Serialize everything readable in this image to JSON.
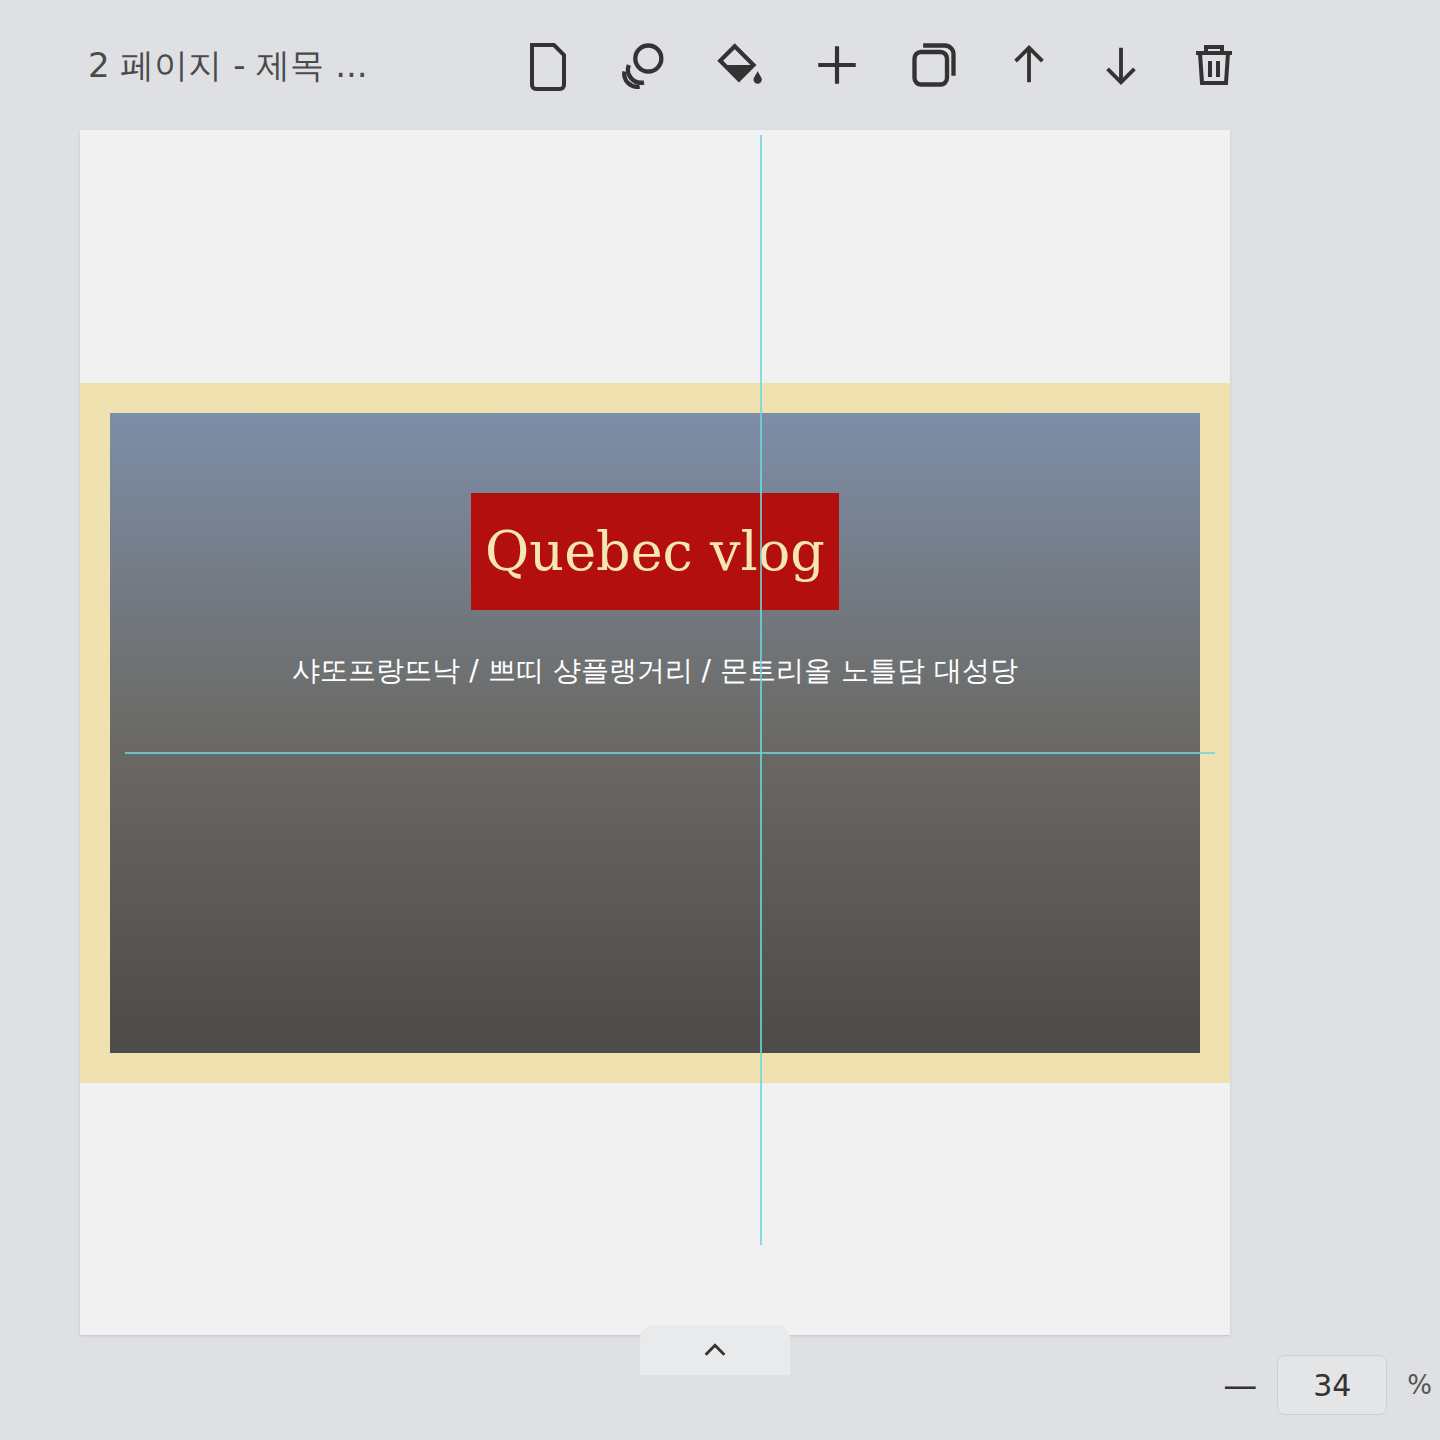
{
  "page_header": {
    "title": "2 페이지 - 제목 ..."
  },
  "canvas": {
    "title_badge": "Quebec vlog",
    "subtitle": "샤또프랑뜨낙 / 쁘띠 샹플랭거리 / 몬트리올 노틀담 대성당"
  },
  "zoom": {
    "minus": "—",
    "value": "34",
    "unit": "%"
  }
}
